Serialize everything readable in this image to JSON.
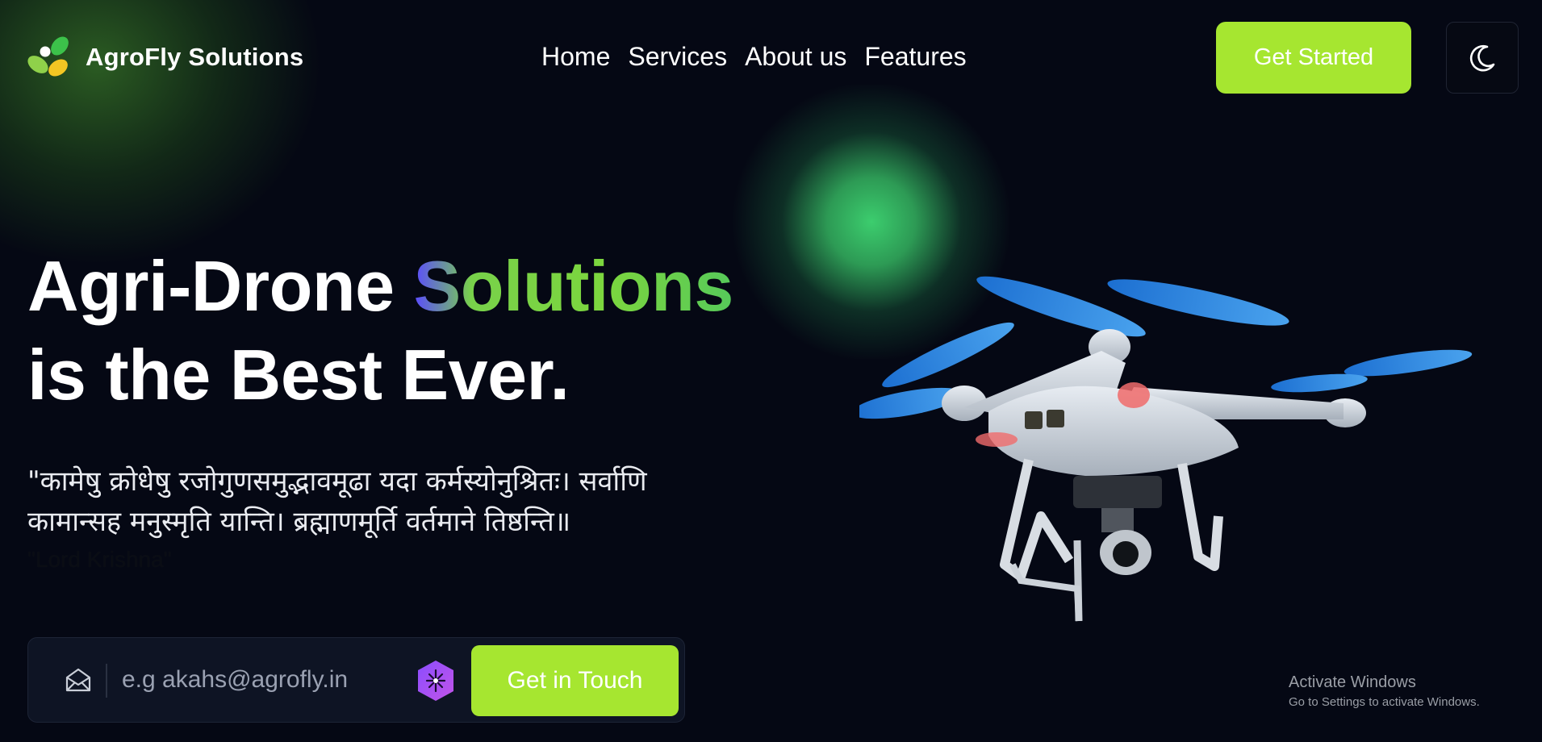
{
  "brand": {
    "name": "AgroFly Solutions",
    "logo_colors": [
      "#3cc24a",
      "#f3c623",
      "#8fd14a",
      "#ffffff"
    ]
  },
  "nav": {
    "items": [
      {
        "label": "Home"
      },
      {
        "label": "Services"
      },
      {
        "label": "About us"
      },
      {
        "label": "Features"
      }
    ]
  },
  "header": {
    "get_started_label": "Get Started",
    "theme_toggle_icon": "moon-icon"
  },
  "hero": {
    "title_part1": "Agri-Drone ",
    "title_accent": "Solutions",
    "title_line2": "is the Best Ever.",
    "quote": "\"कामेषु क्रोधेषु रजोगुणसमुद्भावमूढा यदा कर्मस्योनुश्रितः। सर्वाणि कामान्सह मनुस्मृति यान्ति। ब्रह्माणमूर्ति वर्तमाने तिष्ठन्ति॥",
    "quote_author": "\"Lord Krishna\""
  },
  "contact": {
    "email_placeholder": "e.g akahs@agrofly.in",
    "email_value": "",
    "submit_label": "Get in Touch",
    "mail_icon": "mail-open-icon",
    "extension_icon": "hexagon-sparkle-icon"
  },
  "watermark": {
    "title": "Activate Windows",
    "subtitle": "Go to Settings to activate Windows."
  },
  "colors": {
    "background": "#050814",
    "accent": "#a6e630",
    "glow_green": "#3ccd6e",
    "input_bg": "#0e1424"
  }
}
